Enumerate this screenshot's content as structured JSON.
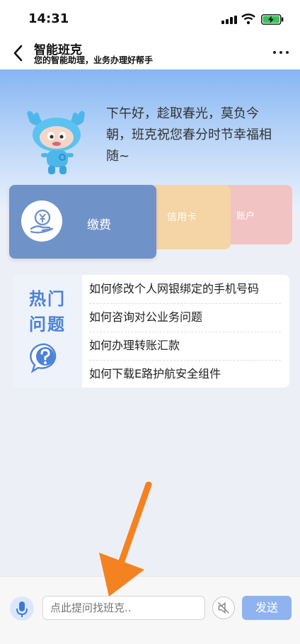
{
  "status_bar": {
    "time": "14:31"
  },
  "header": {
    "title": "智能班克",
    "subtitle": "您的智能助理，业务办理好帮手"
  },
  "hero": {
    "greeting": "下午好，趁取春光，莫负今朝，班克祝您春分时节幸福相随~"
  },
  "service_cards": {
    "pay_label": "缴费",
    "credit_label": "信用卡",
    "account_label": "账户"
  },
  "hot_questions": {
    "title_line1": "热门",
    "title_line2": "问题",
    "items": [
      {
        "label": "如何修改个人网银绑定的手机号码"
      },
      {
        "label": "如何咨询对公业务问题"
      },
      {
        "label": "如何办理转账汇款"
      },
      {
        "label": "如何下载E路护航安全组件"
      }
    ]
  },
  "input_bar": {
    "placeholder": "点此提问找班克..",
    "send_label": "发送"
  },
  "colors": {
    "accent": "#4d82d6",
    "pay_card": "#6f92c8",
    "credit_card": "#f5d4a6",
    "account_card": "#f2c3c3",
    "send_button": "#8fb3ef",
    "annotation_arrow": "#f58220"
  },
  "icons": [
    "signal-icon",
    "wifi-icon",
    "battery-charging-icon",
    "back-arrow-icon",
    "more-icon",
    "mascot-icon",
    "yuan-hand-icon",
    "question-bubble-icon",
    "microphone-icon",
    "mute-icon",
    "annotation-arrow-icon"
  ]
}
